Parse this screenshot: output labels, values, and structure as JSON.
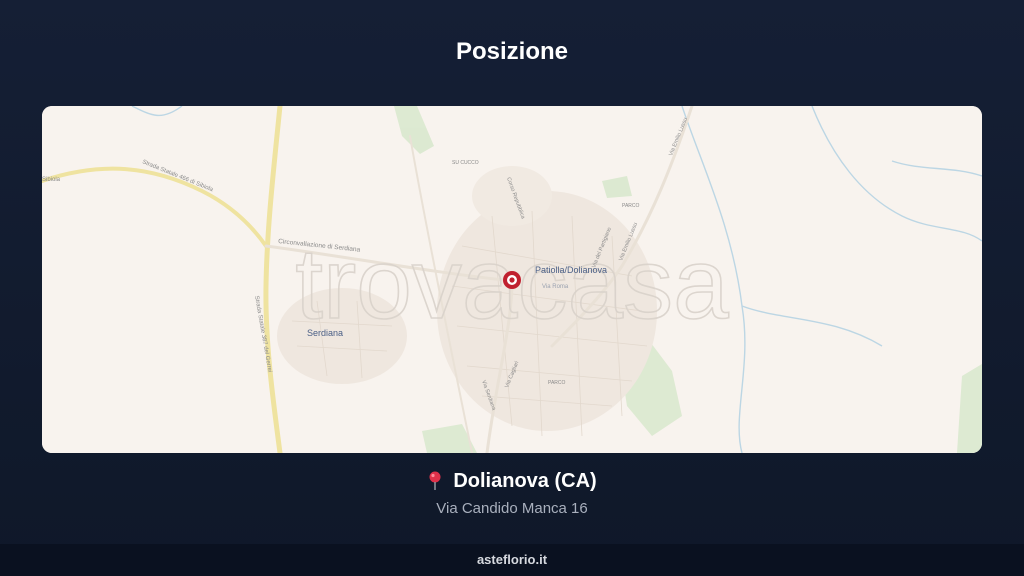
{
  "header": {
    "title": "Posizione"
  },
  "map": {
    "watermark": "trovacasa",
    "labels": {
      "town_main": "Patiolla/Dolianova",
      "town_second": "Serdiana",
      "street_statale_466": "Strada Statale 466 di Sibiola",
      "street_circonvallazione": "Circonvallazione di Serdiana",
      "street_statale_387": "Strada Statale 387 del Gerrei",
      "street_corso": "Corso Repubblica",
      "street_roma": "Via Roma",
      "street_cagliari": "Via Cagliari",
      "street_serdiana": "Via Serdiana",
      "street_emilio_lussu": "Via Emilio Lussu",
      "street_emilio_lussu_2": "Via Emilio Lussu",
      "street_del_partigiano": "Via del Partigiano",
      "sibiola": "Sibiola",
      "su_cucco": "SU CUCCO",
      "parco_1": "PARCO",
      "parco_2": "PARCO"
    },
    "colors": {
      "background": "#f8f3ee",
      "marker": "#c0202f",
      "road": "#f3e9a6",
      "green": "#cfe3c2"
    }
  },
  "location": {
    "pin_icon": "round-pushpin",
    "city": "Dolianova (CA)",
    "address": "Via Candido Manca 16"
  },
  "footer": {
    "site": "asteflorio.it"
  }
}
